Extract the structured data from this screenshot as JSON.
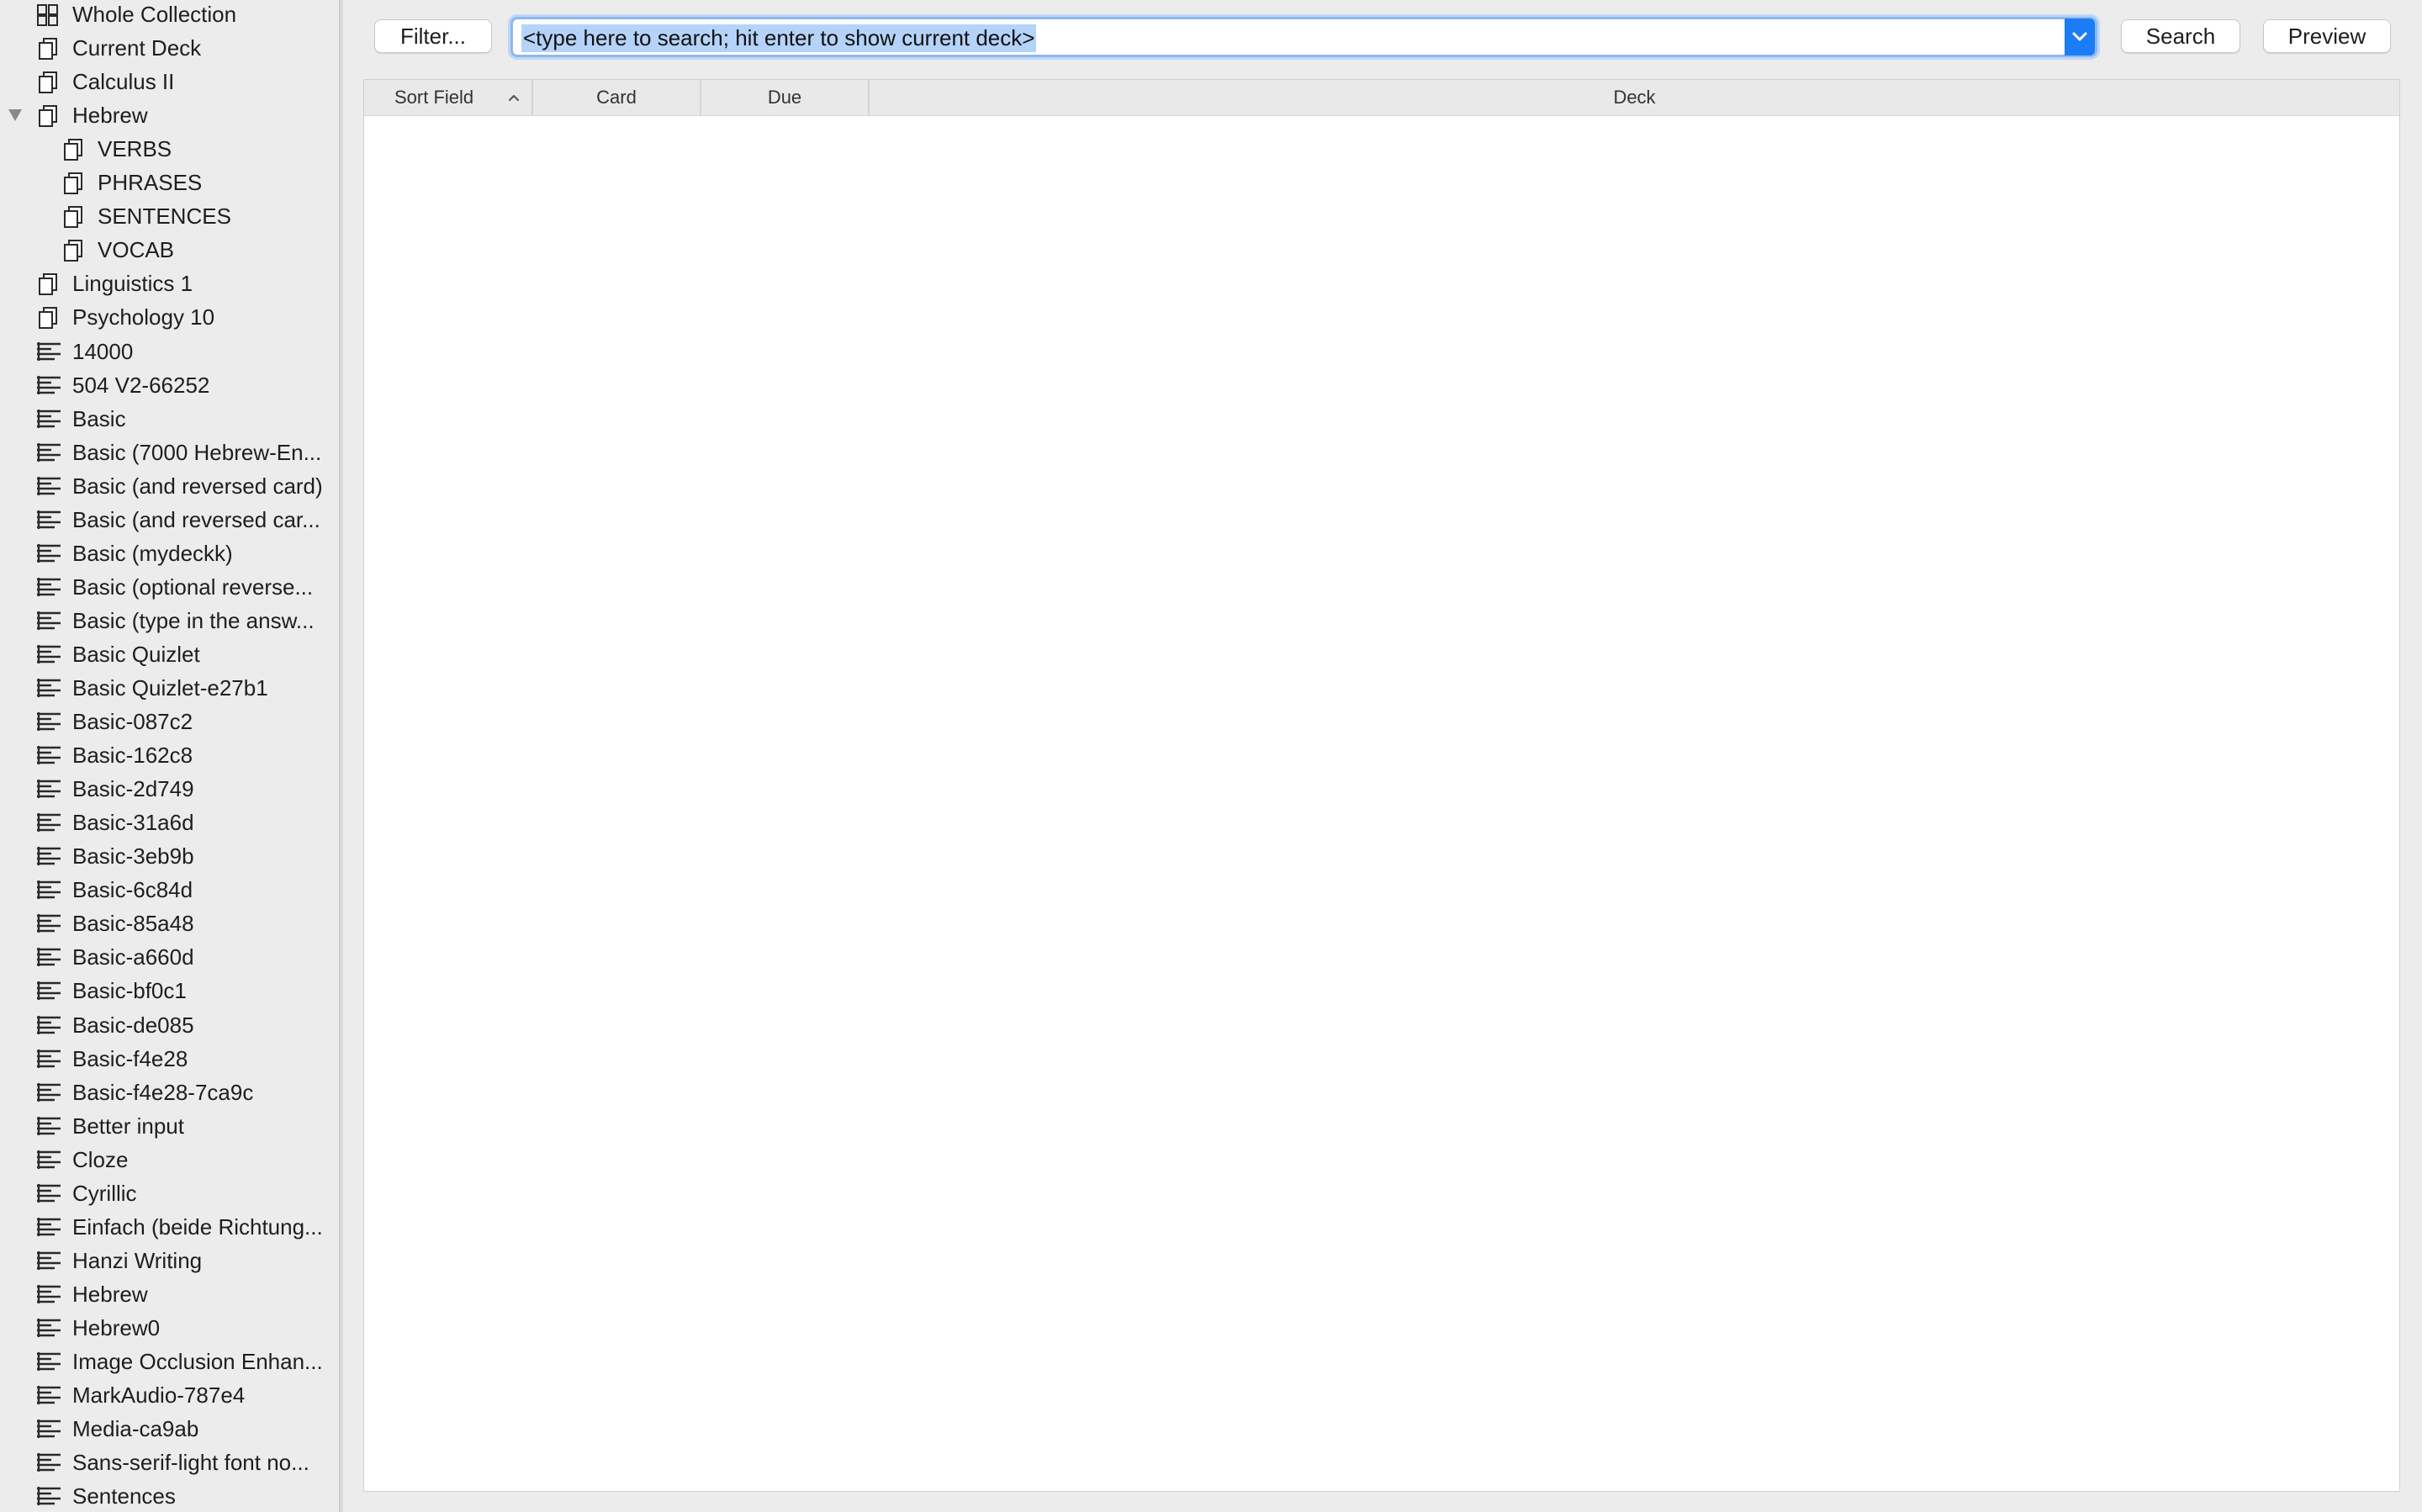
{
  "sidebar": {
    "items": [
      {
        "label": "Whole Collection",
        "icon": "collection-icon",
        "level": 0,
        "expanded": null
      },
      {
        "label": "Current Deck",
        "icon": "deck-icon",
        "level": 0,
        "expanded": null
      },
      {
        "label": "Calculus II",
        "icon": "deck-icon",
        "level": 0,
        "expanded": null
      },
      {
        "label": "Hebrew",
        "icon": "deck-icon",
        "level": 0,
        "expanded": true
      },
      {
        "label": "VERBS",
        "icon": "deck-icon",
        "level": 1,
        "expanded": null
      },
      {
        "label": "PHRASES",
        "icon": "deck-icon",
        "level": 1,
        "expanded": null
      },
      {
        "label": "SENTENCES",
        "icon": "deck-icon",
        "level": 1,
        "expanded": null
      },
      {
        "label": "VOCAB",
        "icon": "deck-icon",
        "level": 1,
        "expanded": null
      },
      {
        "label": "Linguistics 1",
        "icon": "deck-icon",
        "level": 0,
        "expanded": null
      },
      {
        "label": "Psychology 10",
        "icon": "deck-icon",
        "level": 0,
        "expanded": null
      },
      {
        "label": "14000",
        "icon": "note-type-icon",
        "level": 0,
        "expanded": null
      },
      {
        "label": "504 V2-66252",
        "icon": "note-type-icon",
        "level": 0,
        "expanded": null
      },
      {
        "label": "Basic",
        "icon": "note-type-icon",
        "level": 0,
        "expanded": null
      },
      {
        "label": "Basic (7000 Hebrew-En...",
        "icon": "note-type-icon",
        "level": 0,
        "expanded": null
      },
      {
        "label": "Basic (and reversed card)",
        "icon": "note-type-icon",
        "level": 0,
        "expanded": null
      },
      {
        "label": "Basic (and reversed car...",
        "icon": "note-type-icon",
        "level": 0,
        "expanded": null
      },
      {
        "label": "Basic (mydeckk)",
        "icon": "note-type-icon",
        "level": 0,
        "expanded": null
      },
      {
        "label": "Basic (optional reverse...",
        "icon": "note-type-icon",
        "level": 0,
        "expanded": null
      },
      {
        "label": "Basic (type in the answ...",
        "icon": "note-type-icon",
        "level": 0,
        "expanded": null
      },
      {
        "label": "Basic Quizlet",
        "icon": "note-type-icon",
        "level": 0,
        "expanded": null
      },
      {
        "label": "Basic Quizlet-e27b1",
        "icon": "note-type-icon",
        "level": 0,
        "expanded": null
      },
      {
        "label": "Basic-087c2",
        "icon": "note-type-icon",
        "level": 0,
        "expanded": null
      },
      {
        "label": "Basic-162c8",
        "icon": "note-type-icon",
        "level": 0,
        "expanded": null
      },
      {
        "label": "Basic-2d749",
        "icon": "note-type-icon",
        "level": 0,
        "expanded": null
      },
      {
        "label": "Basic-31a6d",
        "icon": "note-type-icon",
        "level": 0,
        "expanded": null
      },
      {
        "label": "Basic-3eb9b",
        "icon": "note-type-icon",
        "level": 0,
        "expanded": null
      },
      {
        "label": "Basic-6c84d",
        "icon": "note-type-icon",
        "level": 0,
        "expanded": null
      },
      {
        "label": "Basic-85a48",
        "icon": "note-type-icon",
        "level": 0,
        "expanded": null
      },
      {
        "label": "Basic-a660d",
        "icon": "note-type-icon",
        "level": 0,
        "expanded": null
      },
      {
        "label": "Basic-bf0c1",
        "icon": "note-type-icon",
        "level": 0,
        "expanded": null
      },
      {
        "label": "Basic-de085",
        "icon": "note-type-icon",
        "level": 0,
        "expanded": null
      },
      {
        "label": "Basic-f4e28",
        "icon": "note-type-icon",
        "level": 0,
        "expanded": null
      },
      {
        "label": "Basic-f4e28-7ca9c",
        "icon": "note-type-icon",
        "level": 0,
        "expanded": null
      },
      {
        "label": "Better input",
        "icon": "note-type-icon",
        "level": 0,
        "expanded": null
      },
      {
        "label": "Cloze",
        "icon": "note-type-icon",
        "level": 0,
        "expanded": null
      },
      {
        "label": "Cyrillic",
        "icon": "note-type-icon",
        "level": 0,
        "expanded": null
      },
      {
        "label": "Einfach (beide Richtung...",
        "icon": "note-type-icon",
        "level": 0,
        "expanded": null
      },
      {
        "label": "Hanzi Writing",
        "icon": "note-type-icon",
        "level": 0,
        "expanded": null
      },
      {
        "label": "Hebrew",
        "icon": "note-type-icon",
        "level": 0,
        "expanded": null
      },
      {
        "label": "Hebrew0",
        "icon": "note-type-icon",
        "level": 0,
        "expanded": null
      },
      {
        "label": "Image Occlusion Enhan...",
        "icon": "note-type-icon",
        "level": 0,
        "expanded": null
      },
      {
        "label": "MarkAudio-787e4",
        "icon": "note-type-icon",
        "level": 0,
        "expanded": null
      },
      {
        "label": "Media-ca9ab",
        "icon": "note-type-icon",
        "level": 0,
        "expanded": null
      },
      {
        "label": "Sans-serif-light font no...",
        "icon": "note-type-icon",
        "level": 0,
        "expanded": null
      },
      {
        "label": "Sentences",
        "icon": "note-type-icon",
        "level": 0,
        "expanded": null
      }
    ]
  },
  "toolbar": {
    "filter_label": "Filter...",
    "search_placeholder": "<type here to search; hit enter to show current deck>",
    "search_button_label": "Search",
    "preview_button_label": "Preview"
  },
  "table": {
    "columns": [
      {
        "label": "Sort Field",
        "sorted": "ascending"
      },
      {
        "label": "Card",
        "sorted": null
      },
      {
        "label": "Due",
        "sorted": null
      },
      {
        "label": "Deck",
        "sorted": null
      }
    ],
    "rows": []
  },
  "colors": {
    "accent": "#1a7df5",
    "selection": "#b5d3f8",
    "focus_ring": "#8fb8ec"
  }
}
